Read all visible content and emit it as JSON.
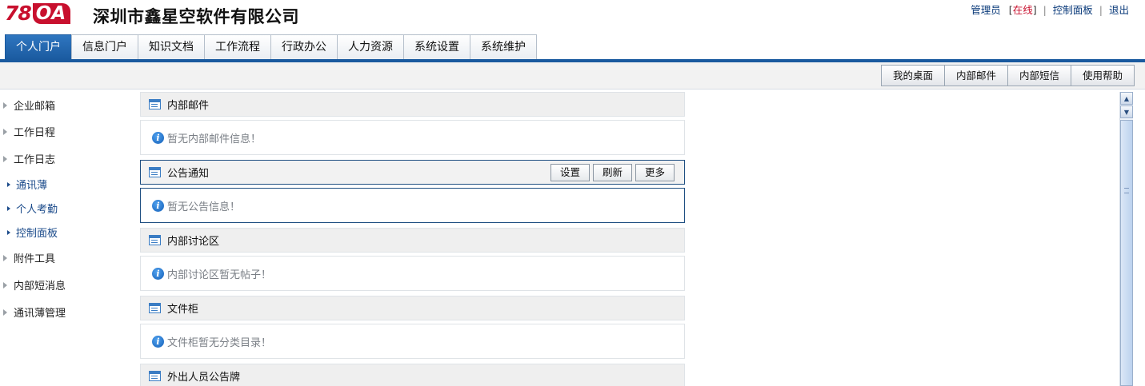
{
  "header": {
    "logo_number": "78",
    "logo_letters": "OA",
    "company_name": "深圳市鑫星空软件有限公司",
    "user_name": "管理员",
    "status_open": "[",
    "status_text": "在线",
    "status_close": "]",
    "separator": "|",
    "control_panel": "控制面板",
    "logout": "退出"
  },
  "main_nav": {
    "tabs": [
      {
        "label": "个人门户",
        "active": true
      },
      {
        "label": "信息门户"
      },
      {
        "label": "知识文档"
      },
      {
        "label": "工作流程"
      },
      {
        "label": "行政办公"
      },
      {
        "label": "人力资源"
      },
      {
        "label": "系统设置"
      },
      {
        "label": "系统维护"
      }
    ]
  },
  "subbar": {
    "buttons": [
      "我的桌面",
      "内部邮件",
      "内部短信",
      "使用帮助"
    ]
  },
  "sidebar": {
    "items": [
      {
        "label": "企业邮箱",
        "sub": false
      },
      {
        "label": "工作日程",
        "sub": false
      },
      {
        "label": "工作日志",
        "sub": false
      },
      {
        "label": "通讯薄",
        "sub": true
      },
      {
        "label": "个人考勤",
        "sub": true
      },
      {
        "label": "控制面板",
        "sub": true
      },
      {
        "label": "附件工具",
        "sub": false
      },
      {
        "label": "内部短消息",
        "sub": false
      },
      {
        "label": "通讯薄管理",
        "sub": false
      }
    ]
  },
  "panels": [
    {
      "title": "内部邮件",
      "message": "暂无内部邮件信息！"
    },
    {
      "title": "公告通知",
      "message": "暂无公告信息！",
      "tools": [
        "设置",
        "刷新",
        "更多"
      ]
    },
    {
      "title": "内部讨论区",
      "message": "内部讨论区暂无帖子！"
    },
    {
      "title": "文件柜",
      "message": "文件柜暂无分类目录！"
    },
    {
      "title": "外出人员公告牌"
    }
  ],
  "icons": {
    "info": "info-icon",
    "panel": "panel-icon",
    "tree_arrow": "triangle-right-icon"
  },
  "colors": {
    "brand_red": "#c8102e",
    "nav_blue": "#1a5a9f",
    "link_blue": "#1a4a8a"
  }
}
